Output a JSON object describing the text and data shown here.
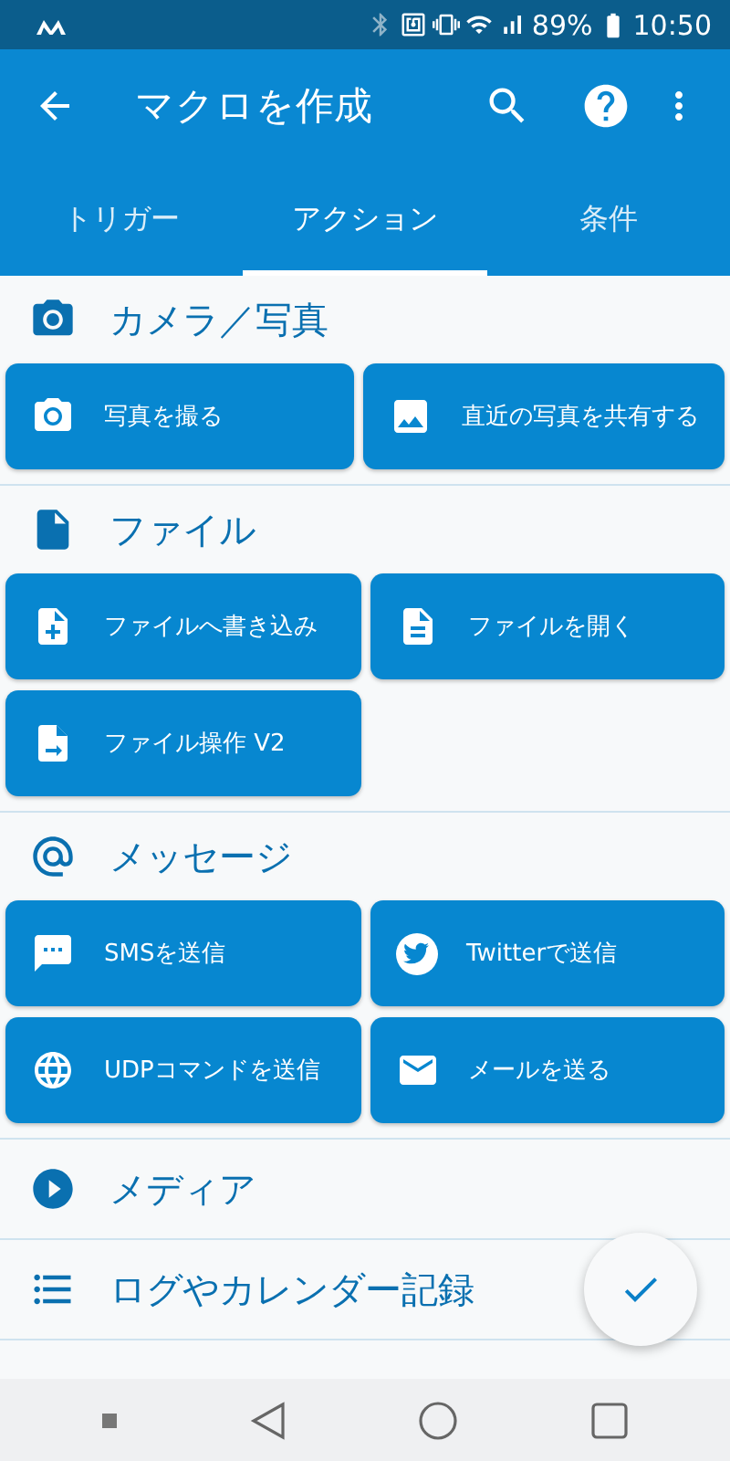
{
  "status_bar": {
    "battery": "89%",
    "time": "10:50"
  },
  "app_bar": {
    "title": "マクロを作成"
  },
  "tabs": [
    {
      "label": "トリガー",
      "selected": false
    },
    {
      "label": "アクション",
      "selected": true
    },
    {
      "label": "条件",
      "selected": false
    }
  ],
  "sections": [
    {
      "title": "カメラ／写真",
      "actions": [
        {
          "label": "写真を撮る"
        },
        {
          "label": "直近の写真を共有する"
        }
      ]
    },
    {
      "title": "ファイル",
      "actions": [
        {
          "label": "ファイルへ書き込み"
        },
        {
          "label": "ファイルを開く"
        },
        {
          "label": "ファイル操作 V2"
        }
      ]
    },
    {
      "title": "メッセージ",
      "actions": [
        {
          "label": "SMSを送信"
        },
        {
          "label": "Twitterで送信"
        },
        {
          "label": "UDPコマンドを送信"
        },
        {
          "label": "メールを送る"
        }
      ]
    },
    {
      "title": "メディア"
    },
    {
      "title": "ログやカレンダー記録"
    }
  ]
}
